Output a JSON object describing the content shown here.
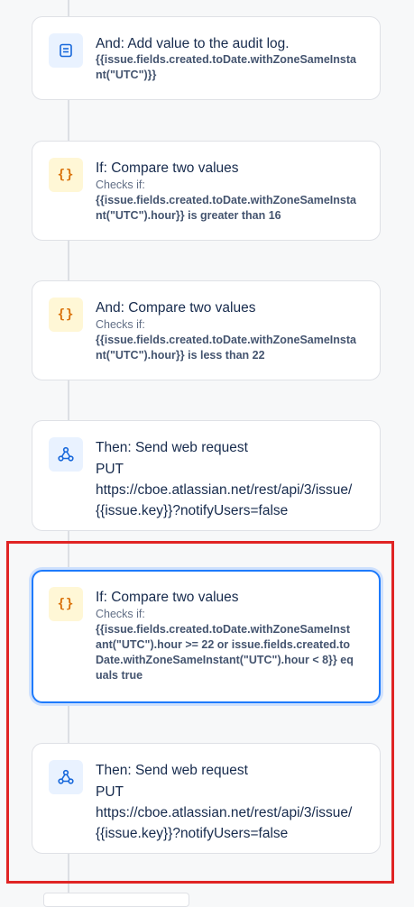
{
  "cards": [
    {
      "icon": "log-icon",
      "title": "And: Add value to the audit log.",
      "sub": "",
      "bold": "{{issue.fields.created.toDate.withZoneSameInstant(\"UTC\")}}",
      "body": ""
    },
    {
      "icon": "braces-icon",
      "title": "If: Compare two values",
      "sub": "Checks if:",
      "bold": "{{issue.fields.created.toDate.withZoneSameInstant(\"UTC\").hour}} is greater than 16",
      "body": ""
    },
    {
      "icon": "braces-icon",
      "title": "And: Compare two values",
      "sub": "Checks if:",
      "bold": "{{issue.fields.created.toDate.withZoneSameInstant(\"UTC\").hour}} is less than 22",
      "body": ""
    },
    {
      "icon": "webhook-icon",
      "title": "Then: Send web request",
      "sub": "",
      "bold": "",
      "body": "PUT\nhttps://cboe.atlassian.net/rest/api/3/issue/{{issue.key}}?notifyUsers=false"
    },
    {
      "icon": "braces-icon",
      "title": "If: Compare two values",
      "sub": "Checks if:",
      "bold": "{{issue.fields.created.toDate.withZoneSameInstant(\"UTC\").hour >= 22 or issue.fields.created.toDate.withZoneSameInstant(\"UTC\").hour < 8}} equals true",
      "body": ""
    },
    {
      "icon": "webhook-icon",
      "title": "Then: Send web request",
      "sub": "",
      "bold": "",
      "body": "PUT\nhttps://cboe.atlassian.net/rest/api/3/issue/{{issue.key}}?notifyUsers=false"
    }
  ],
  "braces_glyph": "{}",
  "colors": {
    "selected": "#1d7afc",
    "highlight": "#e02424",
    "braces": "#d97008",
    "webhook": "#1868db"
  }
}
